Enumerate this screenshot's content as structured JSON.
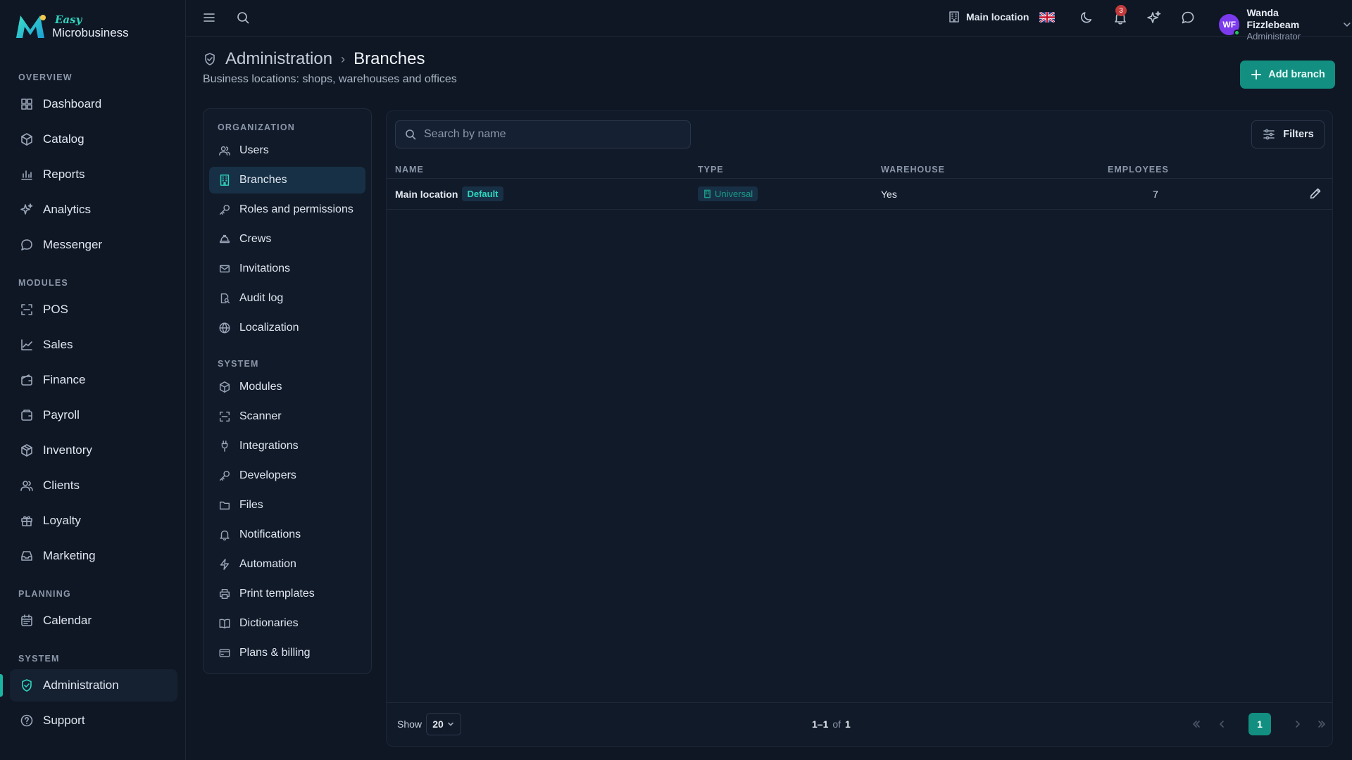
{
  "brand": {
    "easy": "Easy",
    "name": "Microbusiness"
  },
  "sidebar": {
    "sections": [
      {
        "label": "OVERVIEW",
        "items": [
          "Dashboard",
          "Catalog",
          "Reports",
          "Analytics",
          "Messenger"
        ]
      },
      {
        "label": "MODULES",
        "items": [
          "POS",
          "Sales",
          "Finance",
          "Payroll",
          "Inventory",
          "Clients",
          "Loyalty",
          "Marketing"
        ]
      },
      {
        "label": "PLANNING",
        "items": [
          "Calendar"
        ]
      },
      {
        "label": "SYSTEM",
        "items": [
          "Administration",
          "Support"
        ]
      }
    ],
    "active": "Administration"
  },
  "topbar": {
    "location": "Main location",
    "notifications_count": "3",
    "user": {
      "initials": "WF",
      "name": "Wanda Fizzlebeam",
      "role": "Administrator"
    }
  },
  "page": {
    "breadcrumb_parent": "Administration",
    "breadcrumb_sep": "›",
    "title": "Branches",
    "subtitle": "Business locations: shops, warehouses and offices",
    "add_button": "Add branch"
  },
  "submenu": {
    "sections": [
      {
        "label": "ORGANIZATION",
        "items": [
          "Users",
          "Branches",
          "Roles and permissions",
          "Crews",
          "Invitations",
          "Audit log",
          "Localization"
        ]
      },
      {
        "label": "SYSTEM",
        "items": [
          "Modules",
          "Scanner",
          "Integrations",
          "Developers",
          "Files",
          "Notifications",
          "Automation",
          "Print templates",
          "Dictionaries",
          "Plans & billing"
        ]
      }
    ],
    "active": "Branches"
  },
  "table": {
    "search_placeholder": "Search by name",
    "filters_label": "Filters",
    "columns": {
      "name": "NAME",
      "type": "TYPE",
      "warehouse": "WAREHOUSE",
      "employees": "EMPLOYEES"
    },
    "rows": [
      {
        "name": "Main location",
        "badge": "Default",
        "type": "Universal",
        "warehouse": "Yes",
        "employees": "7"
      }
    ]
  },
  "pagination": {
    "show_label": "Show",
    "page_size": "20",
    "range": "1–1",
    "of": "of",
    "total": "1",
    "current_page": "1"
  },
  "colors": {
    "accent": "#128f80",
    "accent_text": "#2fd6c0",
    "background": "#0f1724",
    "panel": "#111a29"
  }
}
